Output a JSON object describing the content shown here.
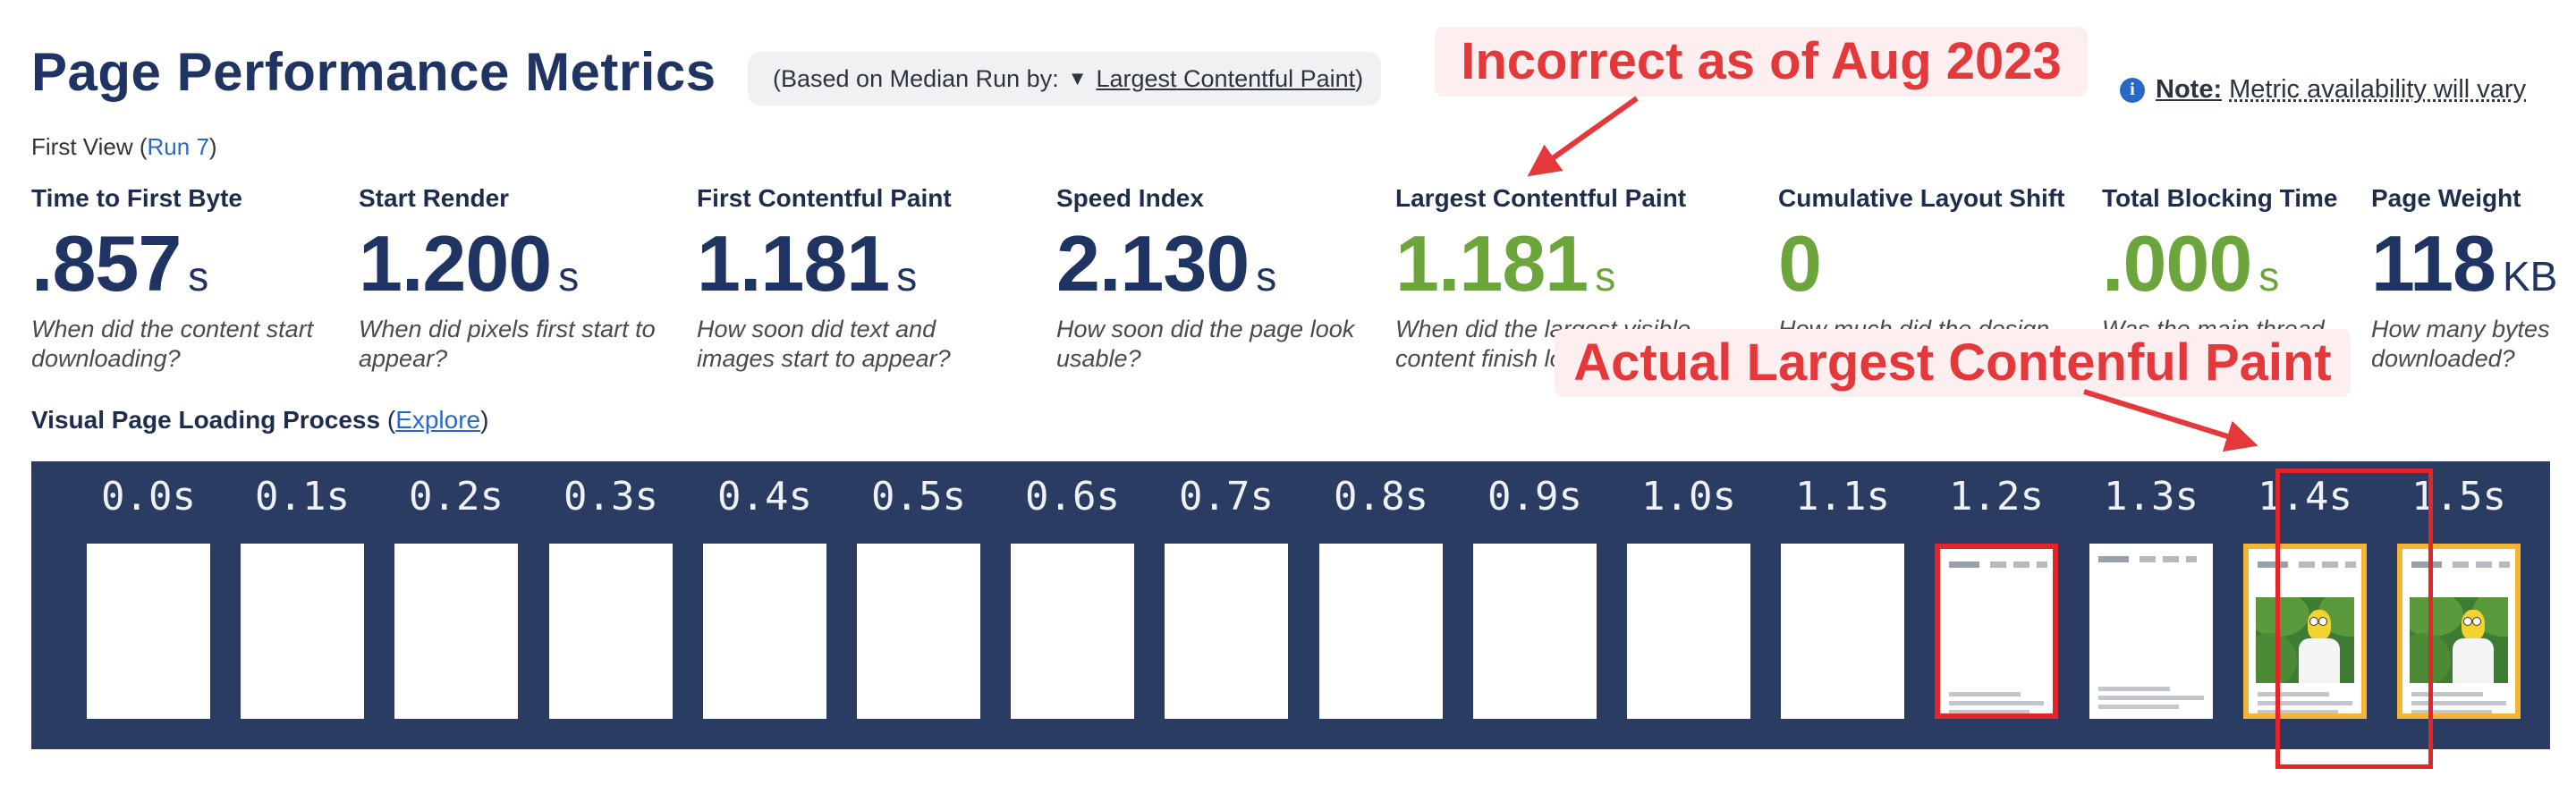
{
  "page": {
    "title": "Page Performance Metrics",
    "median_prefix": "(Based on Median Run by:",
    "median_caret": "▼",
    "median_metric": "Largest Contentful Paint",
    "median_suffix": ")",
    "note_label": "Note:",
    "note_text": "Metric availability will vary",
    "first_view_label": "First View (",
    "run_link": "Run 7",
    "first_view_close": ")"
  },
  "annotations": {
    "callout_top": "Incorrect as of Aug 2023",
    "callout_bottom": "Actual Largest Contenful Paint",
    "color": "#e5383b"
  },
  "metrics": [
    {
      "label": "Time to First Byte",
      "value": ".857",
      "unit": "s",
      "desc": "When did the content start downloading?",
      "good": false
    },
    {
      "label": "Start Render",
      "value": "1.200",
      "unit": "s",
      "desc": "When did pixels first start to appear?",
      "good": false
    },
    {
      "label": "First Contentful Paint",
      "value": "1.181",
      "unit": "s",
      "desc": "How soon did text and images start to appear?",
      "good": false
    },
    {
      "label": "Speed Index",
      "value": "2.130",
      "unit": "s",
      "desc": "How soon did the page look usable?",
      "good": false
    },
    {
      "label": "Largest Contentful Paint",
      "value": "1.181",
      "unit": "s",
      "desc": "When did the largest visible content finish lo",
      "good": true
    },
    {
      "label": "Cumulative Layout Shift",
      "value": "0",
      "unit": "",
      "desc": "How much did the design",
      "good": true
    },
    {
      "label": "Total Blocking Time",
      "value": ".000",
      "unit": "s",
      "desc": "Was the main thread",
      "good": true
    },
    {
      "label": "Page Weight",
      "value": "118",
      "unit": "KB",
      "desc": "How many bytes downloaded?",
      "good": false
    }
  ],
  "visual": {
    "title": "Visual Page Loading Process",
    "explore_open": " (",
    "explore": "Explore",
    "explore_close": ")"
  },
  "filmstrip": [
    {
      "time": "0.0s",
      "content": "blank",
      "border": "none"
    },
    {
      "time": "0.1s",
      "content": "blank",
      "border": "none"
    },
    {
      "time": "0.2s",
      "content": "blank",
      "border": "none"
    },
    {
      "time": "0.3s",
      "content": "blank",
      "border": "none"
    },
    {
      "time": "0.4s",
      "content": "blank",
      "border": "none"
    },
    {
      "time": "0.5s",
      "content": "blank",
      "border": "none"
    },
    {
      "time": "0.6s",
      "content": "blank",
      "border": "none"
    },
    {
      "time": "0.7s",
      "content": "blank",
      "border": "none"
    },
    {
      "time": "0.8s",
      "content": "blank",
      "border": "none"
    },
    {
      "time": "0.9s",
      "content": "blank",
      "border": "none"
    },
    {
      "time": "1.0s",
      "content": "blank",
      "border": "none"
    },
    {
      "time": "1.1s",
      "content": "blank",
      "border": "none"
    },
    {
      "time": "1.2s",
      "content": "text",
      "border": "red"
    },
    {
      "time": "1.3s",
      "content": "text",
      "border": "none"
    },
    {
      "time": "1.4s",
      "content": "image",
      "border": "orange"
    },
    {
      "time": "1.5s",
      "content": "image",
      "border": "orange"
    }
  ]
}
